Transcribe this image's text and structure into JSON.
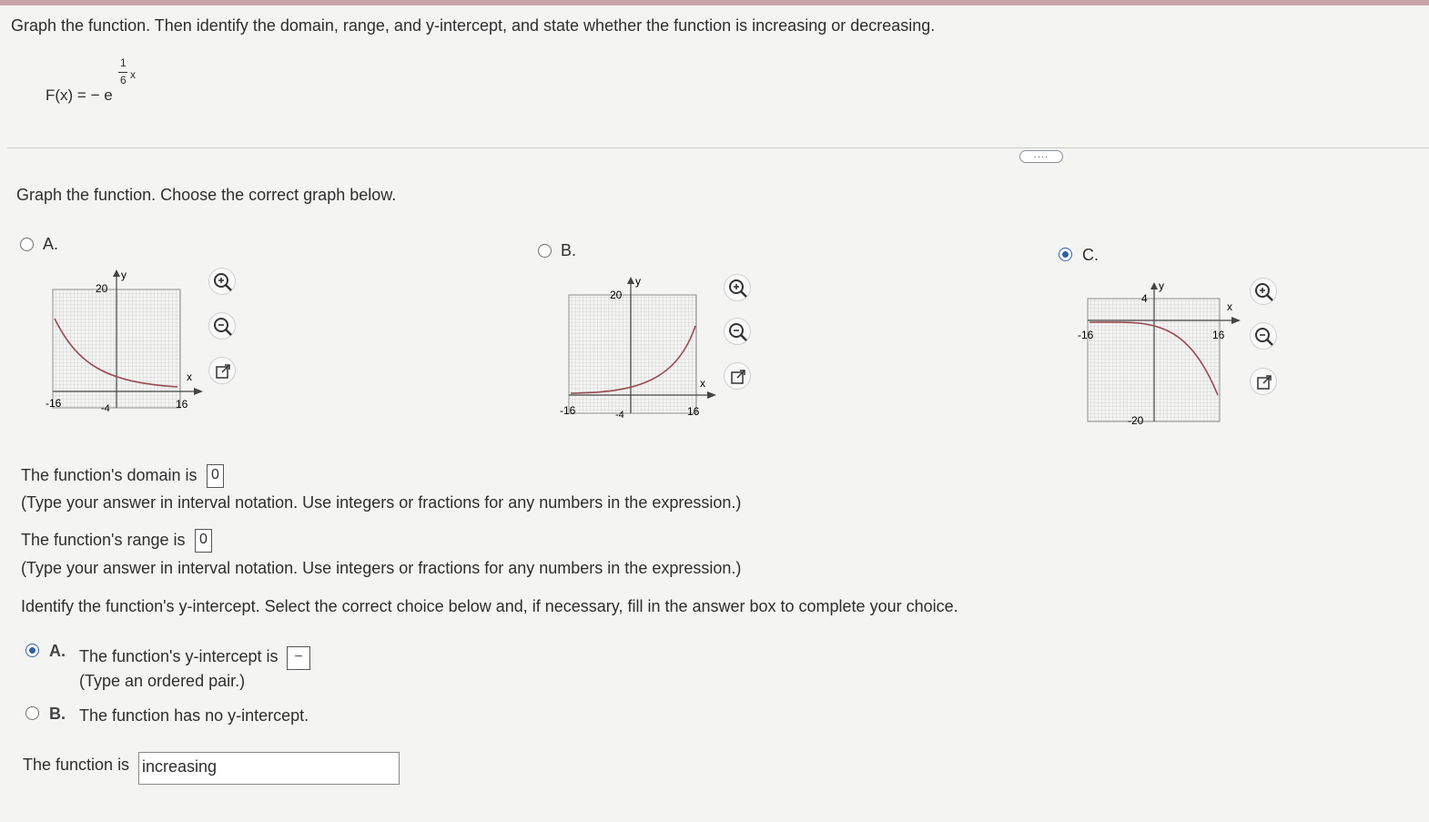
{
  "question": {
    "instruction": "Graph the function. Then identify the domain, range, and y-intercept, and state whether the function is increasing or decreasing.",
    "function_lhs": "F(x) = − e",
    "exp_num": "1",
    "exp_den": "6",
    "exp_var": "x"
  },
  "more_button": "....",
  "graph_part": {
    "prompt": "Graph the function. Choose the correct graph below.",
    "options": [
      {
        "label": "A.",
        "selected": false,
        "x_label": "x",
        "y_label": "y",
        "top_tick": "20",
        "left_tick": "-16",
        "mid_tick": "-4",
        "right_tick": "16"
      },
      {
        "label": "B.",
        "selected": false,
        "x_label": "x",
        "y_label": "y",
        "top_tick": "20",
        "left_tick": "-16",
        "mid_tick": "-4",
        "right_tick": "16"
      },
      {
        "label": "C.",
        "selected": true,
        "x_label": "x",
        "y_label": "y",
        "top_tick": "4",
        "left_tick": "-16",
        "right_tick": "16",
        "bottom_tick": "-20"
      }
    ]
  },
  "domain": {
    "prefix": "The function's domain is",
    "value": "0",
    "hint": "(Type your answer in interval notation. Use integers or fractions for any numbers in the expression.)"
  },
  "range": {
    "prefix": "The function's range is",
    "value": "0",
    "hint": "(Type your answer in interval notation. Use integers or fractions for any numbers in the expression.)"
  },
  "yintercept": {
    "prompt": "Identify the function's y-intercept. Select the correct choice below and, if necessary, fill in the answer box to complete your choice.",
    "choice_a_letter": "A.",
    "choice_a_text": "The function's y-intercept is",
    "choice_a_box": "−",
    "choice_a_hint": "(Type an ordered pair.)",
    "choice_b_letter": "B.",
    "choice_b_text": "The function has no y-intercept."
  },
  "monotonic": {
    "prefix": "The function is",
    "value": "increasing"
  },
  "colors": {
    "curve": "#9a4a52",
    "selected_radio": "#2f5fa8"
  }
}
